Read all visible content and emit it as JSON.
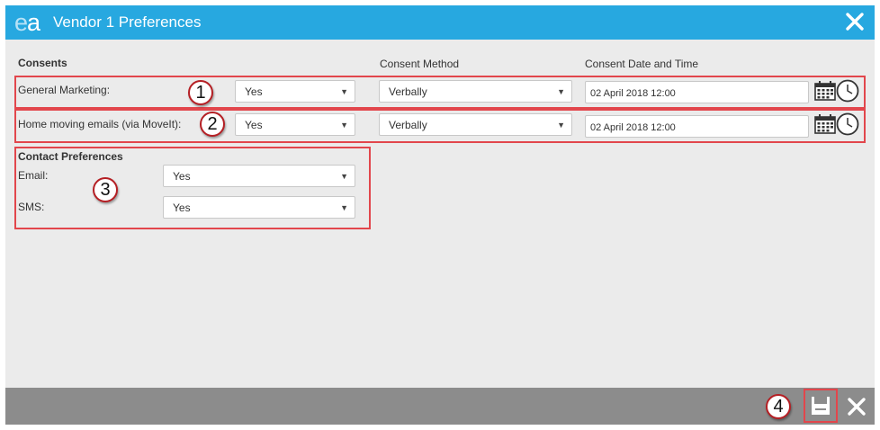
{
  "window": {
    "logo_text_e": "e",
    "logo_text_a": "a",
    "title": "Vendor 1 Preferences"
  },
  "consents": {
    "section_title": "Consents",
    "col_method": "Consent Method",
    "col_datetime": "Consent Date and Time",
    "rows": [
      {
        "label": "General Marketing:",
        "consent": "Yes",
        "method": "Verbally",
        "datetime": "02 April 2018 12:00"
      },
      {
        "label": "Home moving emails (via MoveIt):",
        "consent": "Yes",
        "method": "Verbally",
        "datetime": "02 April 2018 12:00"
      }
    ]
  },
  "contact_preferences": {
    "section_title": "Contact Preferences",
    "rows": [
      {
        "label": "Email:",
        "value": "Yes"
      },
      {
        "label": "SMS:",
        "value": "Yes"
      }
    ]
  },
  "annotations": [
    "1",
    "2",
    "3",
    "4"
  ],
  "icons": {
    "dropdown_arrow": "▼",
    "calendar": "calendar-icon",
    "clock": "clock-icon",
    "save": "save-icon",
    "close": "close-icon"
  },
  "colors": {
    "titlebar": "#27a8e0",
    "body": "#ebebeb",
    "footer": "#8c8c8c",
    "annotation": "#e2464c"
  }
}
